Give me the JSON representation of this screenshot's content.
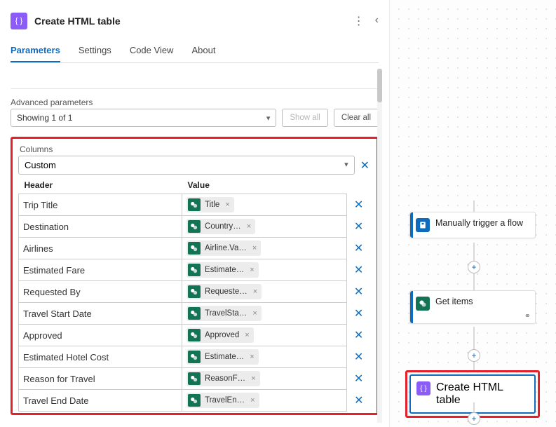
{
  "header": {
    "title": "Create HTML table"
  },
  "tabs": [
    "Parameters",
    "Settings",
    "Code View",
    "About"
  ],
  "advanced": {
    "label": "Advanced parameters",
    "showing": "Showing 1 of 1",
    "show_all": "Show all",
    "clear_all": "Clear all"
  },
  "columns": {
    "section_label": "Columns",
    "mode": "Custom",
    "headers": {
      "header": "Header",
      "value": "Value"
    },
    "rows": [
      {
        "header": "Trip Title",
        "token": "Title"
      },
      {
        "header": "Destination",
        "token": "Country…"
      },
      {
        "header": "Airlines",
        "token": "Airline.Va…"
      },
      {
        "header": "Estimated Fare",
        "token": "Estimate…"
      },
      {
        "header": "Requested By",
        "token": "Requeste…"
      },
      {
        "header": "Travel Start Date",
        "token": "TravelSta…"
      },
      {
        "header": "Approved",
        "token": "Approved"
      },
      {
        "header": "Estimated Hotel Cost",
        "token": "Estimate…"
      },
      {
        "header": "Reason for Travel",
        "token": "ReasonF…"
      },
      {
        "header": "Travel End Date",
        "token": "TravelEn…"
      }
    ]
  },
  "canvas": {
    "node1": "Manually trigger a flow",
    "node2": "Get items",
    "node3": "Create HTML table"
  }
}
